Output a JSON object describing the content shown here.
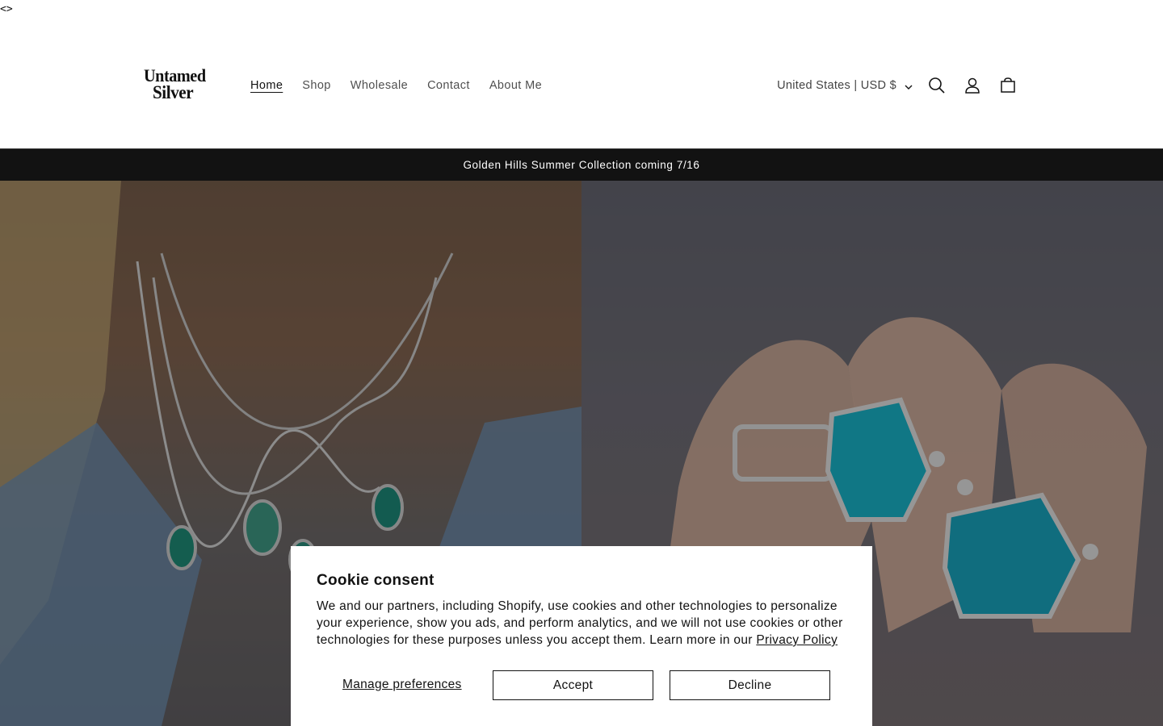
{
  "stray_text": "<>",
  "logo": {
    "line1": "Untamed",
    "line2": "Silver"
  },
  "nav": {
    "items": [
      {
        "label": "Home",
        "active": true
      },
      {
        "label": "Shop"
      },
      {
        "label": "Wholesale"
      },
      {
        "label": "Contact"
      },
      {
        "label": "About Me"
      }
    ]
  },
  "header": {
    "localization": "United States | USD $",
    "icons": [
      "search-icon",
      "account-icon",
      "cart-icon"
    ]
  },
  "announcement": {
    "text": "Golden Hills Summer Collection coming 7/16"
  },
  "hero": {
    "left_image": "necklaces-turquoise-pendants",
    "right_image": "rings-turquoise-stones"
  },
  "cookie_consent": {
    "title": "Cookie consent",
    "body": "We and our partners, including Shopify, use cookies and other technologies to personalize your experience, show you ads, and perform analytics, and we will not use cookies or other technologies for these purposes unless you accept them. Learn more in our ",
    "privacy_link": "Privacy Policy",
    "manage_label": "Manage preferences",
    "accept_label": "Accept",
    "decline_label": "Decline"
  }
}
